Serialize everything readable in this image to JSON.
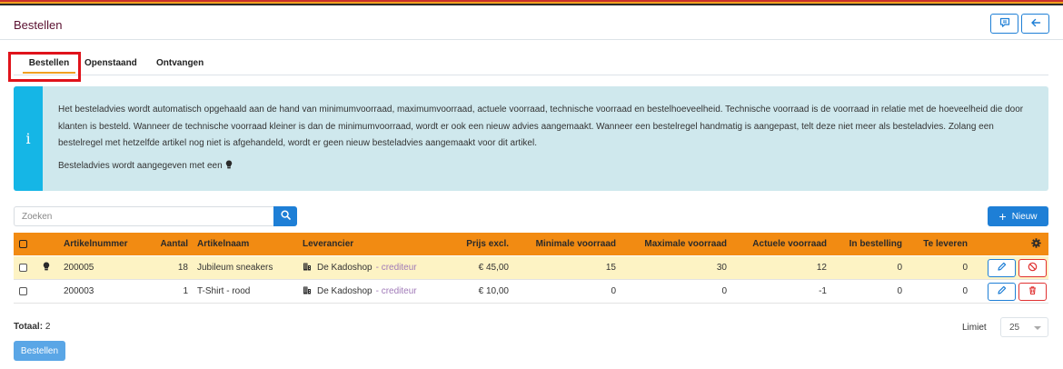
{
  "page": {
    "title": "Bestellen"
  },
  "header_buttons": [
    {
      "icon": "comment-icon"
    },
    {
      "icon": "arrow-left-icon"
    }
  ],
  "tabs": [
    {
      "label": "Bestellen",
      "active": true
    },
    {
      "label": "Openstaand",
      "active": false
    },
    {
      "label": "Ontvangen",
      "active": false
    }
  ],
  "info": {
    "icon": "info-icon",
    "text": "Het besteladvies wordt automatisch opgehaald aan de hand van minimumvoorraad, maximumvoorraad, actuele voorraad, technische voorraad en bestelhoeveelheid. Technische voorraad is de voorraad in relatie met de hoeveelheid die door klanten is besteld. Wanneer de technische voorraad kleiner is dan de minimumvoorraad, wordt er ook een nieuw advies aangemaakt. Wanneer een bestelregel handmatig is aangepast, telt deze niet meer als besteladvies. Zolang een bestelregel met hetzelfde artikel nog niet is afgehandeld, wordt er geen nieuw besteladvies aangemaakt voor dit artikel.",
    "advice_text": "Besteladvies wordt aangegeven met een",
    "advice_icon": "lightbulb-icon"
  },
  "search": {
    "placeholder": "Zoeken",
    "value": ""
  },
  "new_button": {
    "label": "Nieuw"
  },
  "table": {
    "columns": {
      "artikelnummer": "Artikelnummer",
      "aantal": "Aantal",
      "artikelnaam": "Artikelnaam",
      "leverancier": "Leverancier",
      "prijs": "Prijs excl.",
      "min": "Minimale voorraad",
      "max": "Maximale voorraad",
      "actueel": "Actuele voorraad",
      "in_bestelling": "In bestelling",
      "te_leveren": "Te leveren"
    },
    "rows": [
      {
        "advice": true,
        "artikelnummer": "200005",
        "aantal": "18",
        "artikelnaam": "Jubileum sneakers",
        "leverancier": "De Kadoshop",
        "leverancier_type": "- crediteur",
        "prijs": "€ 45,00",
        "min": "15",
        "max": "30",
        "actueel": "12",
        "in_bestelling": "0",
        "te_leveren": "0"
      },
      {
        "advice": false,
        "artikelnummer": "200003",
        "aantal": "1",
        "artikelnaam": "T-Shirt - rood",
        "leverancier": "De Kadoshop",
        "leverancier_type": "- crediteur",
        "prijs": "€ 10,00",
        "min": "0",
        "max": "0",
        "actueel": "-1",
        "in_bestelling": "0",
        "te_leveren": "0"
      }
    ]
  },
  "footer": {
    "total_label": "Totaal:",
    "total_value": "2",
    "limit_label": "Limiet",
    "limit_value": "25",
    "order_button": "Bestellen"
  },
  "colors": {
    "primary": "#1e7fd6",
    "table_header": "#f28b12",
    "advice_row": "#fdf3c4",
    "info_bg": "#cfe8ed",
    "info_bar": "#15b6e6",
    "danger": "#e03131"
  }
}
